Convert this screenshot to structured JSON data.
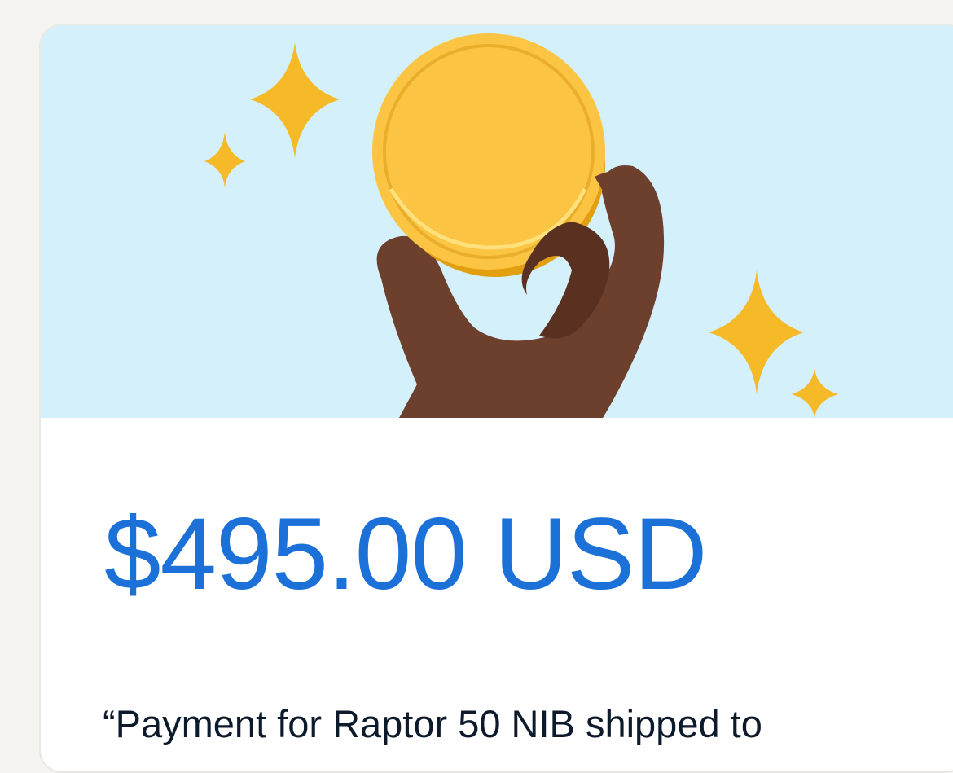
{
  "payment": {
    "amount": "$495.00 USD",
    "note": "“Payment for Raptor 50 NIB shipped to"
  },
  "illustration": {
    "icon": "hand-holding-coin-icon",
    "colors": {
      "background": "#d4f0fb",
      "coin": "#fcc443",
      "sparkle": "#f6b928",
      "hand": "#6d402d"
    }
  },
  "colors": {
    "amount_text": "#1c71d8",
    "body_text": "#0d1a2c",
    "page_background": "#f5f4f1"
  }
}
